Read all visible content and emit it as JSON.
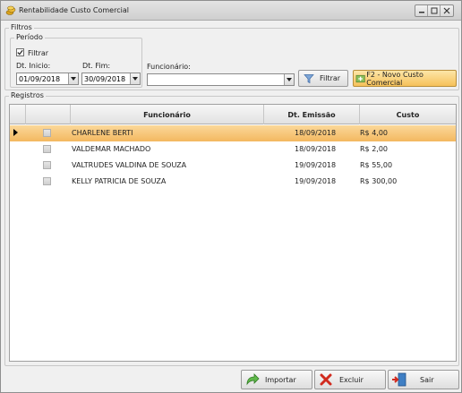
{
  "window": {
    "title": "Rentabilidade Custo Comercial",
    "controls": [
      "minimize",
      "maximize",
      "close"
    ]
  },
  "filters": {
    "group_label": "Filtros",
    "period": {
      "group_label": "Período",
      "filter_checkbox_label": "Filtrar",
      "filter_checked": true,
      "start_label": "Dt. Inicio:",
      "start_value": "01/09/2018",
      "end_label": "Dt. Fim:",
      "end_value": "30/09/2018"
    },
    "employee_label": "Funcionário:",
    "employee_value": "",
    "filter_button": "Filtrar",
    "new_button": "F2 - Novo Custo Comercial"
  },
  "records": {
    "group_label": "Registros",
    "columns": [
      "Funcionário",
      "Dt. Emissão",
      "Custo"
    ],
    "rows": [
      {
        "name": "CHARLENE BERTI",
        "date": "18/09/2018",
        "cost": "R$ 4,00",
        "selected": true
      },
      {
        "name": "VALDEMAR MACHADO",
        "date": "18/09/2018",
        "cost": "R$ 2,00",
        "selected": false
      },
      {
        "name": "VALTRUDES VALDINA DE SOUZA",
        "date": "19/09/2018",
        "cost": "R$ 55,00",
        "selected": false
      },
      {
        "name": "KELLY PATRICIA DE SOUZA",
        "date": "19/09/2018",
        "cost": "R$ 300,00",
        "selected": false
      }
    ]
  },
  "footer": {
    "import_button": "Importar",
    "delete_button": "Excluir",
    "exit_button": "Sair"
  },
  "colors": {
    "selected_row": "#f6c56f",
    "new_button": "#f6c15a",
    "window_bg": "#f0f0f0"
  },
  "icons": {
    "title": "coins-icon",
    "filter": "funnel-icon",
    "new": "add-icon",
    "import": "green-arrow-icon",
    "delete": "red-x-icon",
    "exit": "exit-door-icon"
  }
}
